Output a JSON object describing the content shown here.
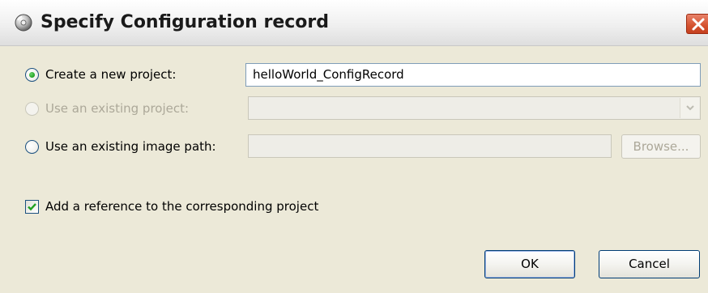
{
  "dialog": {
    "title": "Specify Configuration record",
    "title_icon": "cd-disc-icon",
    "close_icon": "close-icon"
  },
  "options": {
    "create_new_label": "Create a new project:",
    "create_new_value": "helloWorld_ConfigRecord",
    "create_new_checked": true,
    "existing_project_label": "Use an existing project:",
    "existing_project_enabled": false,
    "existing_project_value": "",
    "existing_image_label": "Use an existing image path:",
    "existing_image_value": "",
    "browse_label": "Browse...",
    "browse_enabled": false
  },
  "reference": {
    "label": "Add a reference to the corresponding project",
    "checked": true
  },
  "buttons": {
    "ok_label": "OK",
    "cancel_label": "Cancel"
  },
  "colors": {
    "window_bg": "#ece9d8",
    "close_button": "#d5522f",
    "field_border": "#7f9db9",
    "disabled_text": "#aca899"
  }
}
